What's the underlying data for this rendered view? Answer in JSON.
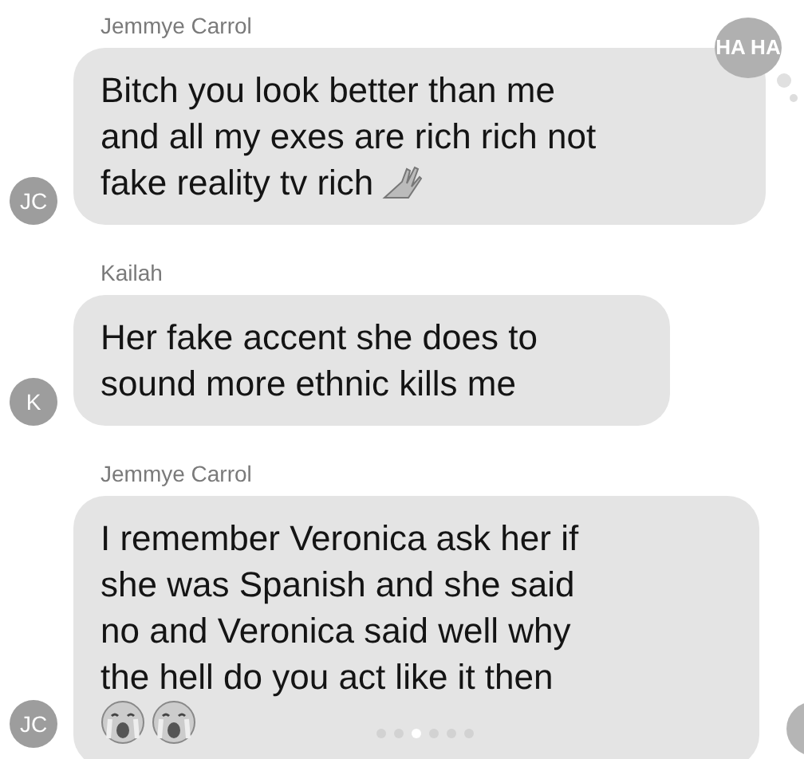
{
  "messages": [
    {
      "sender": "Jemmye Carrol",
      "avatar": "JC",
      "lines": [
        "Bitch you look better than me",
        "and all my exes are rich rich not",
        "fake reality tv rich"
      ],
      "emoji": [
        {
          "kind": "hand"
        }
      ],
      "reaction": {
        "label": "HA HA"
      }
    },
    {
      "sender": "Kailah",
      "avatar": "K",
      "lines": [
        "Her fake accent she does to",
        "sound more ethnic kills me"
      ]
    },
    {
      "sender": "Jemmye Carrol",
      "avatar": "JC",
      "lines": [
        "I remember Veronica ask her if",
        "she was Spanish and she said",
        "no and Veronica said well why",
        "the hell do you act like it then"
      ],
      "emoji": [
        {
          "kind": "crying"
        },
        {
          "kind": "crying"
        }
      ]
    }
  ],
  "page_dots": [
    {
      "selected": false
    },
    {
      "selected": false
    },
    {
      "selected": true
    },
    {
      "selected": false
    },
    {
      "selected": false
    },
    {
      "selected": false
    }
  ]
}
